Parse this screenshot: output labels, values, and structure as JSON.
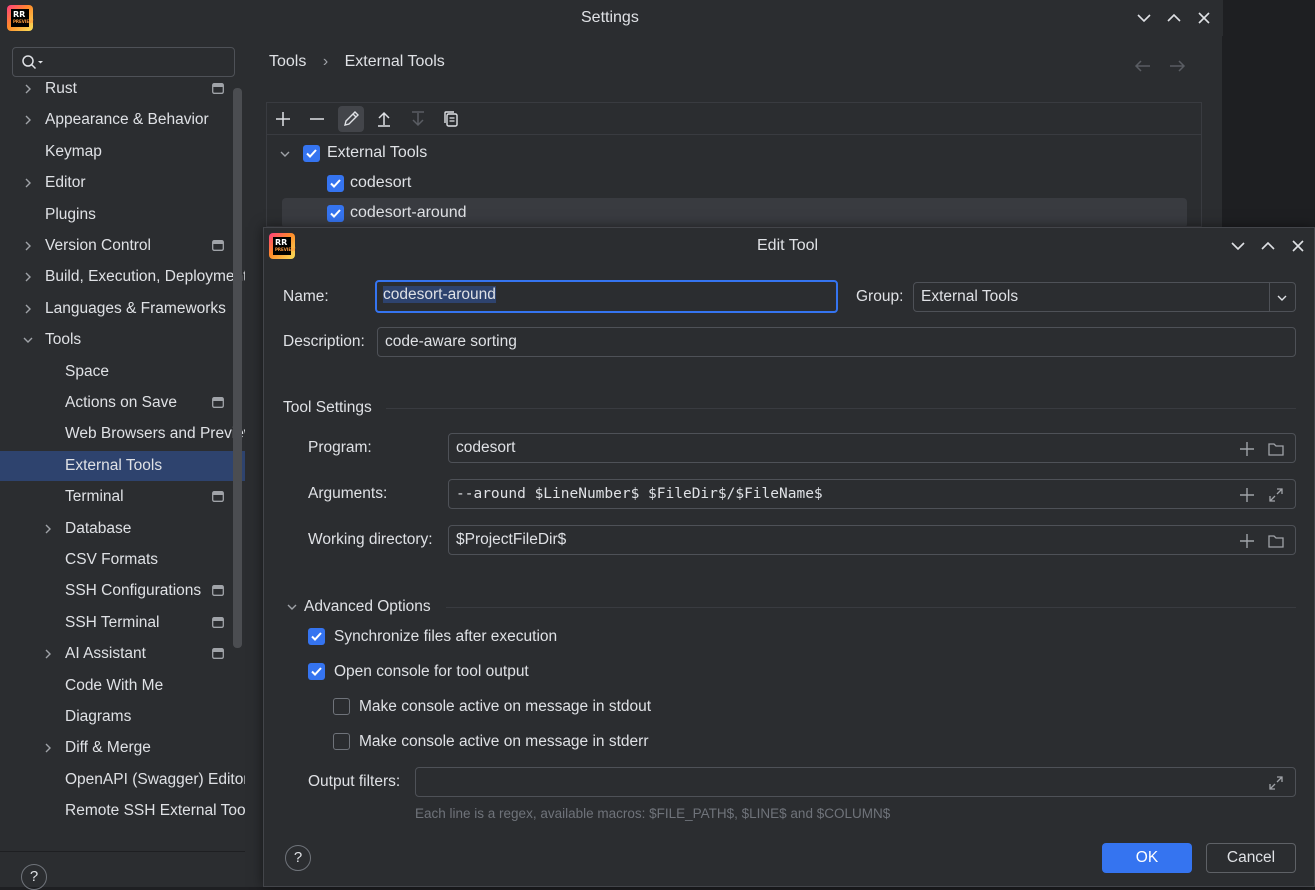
{
  "settings": {
    "title": "Settings",
    "search": {
      "placeholder": ""
    },
    "sidebar": {
      "items": [
        {
          "label": "Rust",
          "expander": "collapsed",
          "project": true
        },
        {
          "label": "Appearance & Behavior",
          "expander": "collapsed",
          "project": false
        },
        {
          "label": "Keymap",
          "expander": "none",
          "project": false
        },
        {
          "label": "Editor",
          "expander": "collapsed",
          "project": false
        },
        {
          "label": "Plugins",
          "expander": "none",
          "project": false
        },
        {
          "label": "Version Control",
          "expander": "collapsed",
          "project": true
        },
        {
          "label": "Build, Execution, Deployment",
          "expander": "collapsed",
          "project": false
        },
        {
          "label": "Languages & Frameworks",
          "expander": "collapsed",
          "project": false
        },
        {
          "label": "Tools",
          "expander": "expanded",
          "project": false
        },
        {
          "label": "Space",
          "expander": "none",
          "project": false
        },
        {
          "label": "Actions on Save",
          "expander": "none",
          "project": true
        },
        {
          "label": "Web Browsers and Preview",
          "expander": "none",
          "project": false
        },
        {
          "label": "External Tools",
          "expander": "none",
          "project": false,
          "selected": true
        },
        {
          "label": "Terminal",
          "expander": "none",
          "project": true
        },
        {
          "label": "Database",
          "expander": "collapsed",
          "project": false
        },
        {
          "label": "CSV Formats",
          "expander": "none",
          "project": false
        },
        {
          "label": "SSH Configurations",
          "expander": "none",
          "project": true
        },
        {
          "label": "SSH Terminal",
          "expander": "none",
          "project": true
        },
        {
          "label": "AI Assistant",
          "expander": "collapsed",
          "project": true
        },
        {
          "label": "Code With Me",
          "expander": "none",
          "project": false
        },
        {
          "label": "Diagrams",
          "expander": "none",
          "project": false
        },
        {
          "label": "Diff & Merge",
          "expander": "collapsed",
          "project": false
        },
        {
          "label": "OpenAPI (Swagger) Editor",
          "expander": "none",
          "project": false
        },
        {
          "label": "Remote SSH External Tools",
          "expander": "none",
          "project": false
        }
      ]
    },
    "breadcrumb": {
      "parent": "Tools",
      "separator": "›",
      "current": "External Tools"
    },
    "help_label": "?",
    "tools_tree": {
      "group": {
        "label": "External Tools",
        "checked": true
      },
      "tools": [
        {
          "label": "codesort",
          "checked": true
        },
        {
          "label": "codesort-around",
          "checked": true,
          "selected": true
        }
      ]
    },
    "toolbar_icons": [
      "add-icon",
      "remove-icon",
      "edit-icon",
      "move-up-icon",
      "move-down-icon",
      "copy-icon"
    ]
  },
  "dialog": {
    "title": "Edit Tool",
    "name_label": "Name:",
    "name_value": "codesort-around",
    "group_label": "Group:",
    "group_value": "External Tools",
    "description_label": "Description:",
    "description_value": "code-aware sorting",
    "tool_settings_title": "Tool Settings",
    "program_label": "Program:",
    "program_value": "codesort",
    "arguments_label": "Arguments:",
    "arguments_value": "--around $LineNumber$ $FileDir$/$FileName$",
    "workdir_label": "Working directory:",
    "workdir_value": "$ProjectFileDir$",
    "advanced_title": "Advanced Options",
    "sync_label": "Synchronize files after execution",
    "sync_checked": true,
    "console_label": "Open console for tool output",
    "console_checked": true,
    "stdout_label": "Make console active on message in stdout",
    "stdout_checked": false,
    "stderr_label": "Make console active on message in stderr",
    "stderr_checked": false,
    "output_filters_label": "Output filters:",
    "output_filters_value": "",
    "output_filters_hint": "Each line is a regex, available macros: $FILE_PATH$, $LINE$ and $COLUMN$",
    "help_label": "?",
    "ok_label": "OK",
    "cancel_label": "Cancel"
  },
  "app_icon": {
    "text": "RR",
    "subtext": "PREVIEW"
  },
  "colors": {
    "accent": "#3574f0",
    "selection": "#2e436e",
    "background": "#2b2d30",
    "border": "#4e5157",
    "text": "#dfe1e5",
    "muted": "#6f737a"
  }
}
